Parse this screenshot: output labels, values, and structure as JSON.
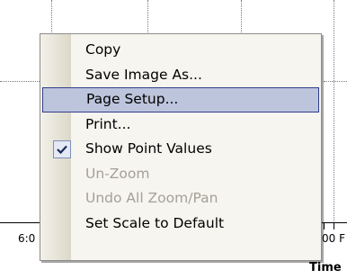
{
  "axis": {
    "tick_left": "6:0",
    "tick_right": "00 F",
    "title_fragment": "Time"
  },
  "menu": {
    "items": [
      {
        "label": "Copy",
        "state": "normal"
      },
      {
        "label": "Save Image As...",
        "state": "normal"
      },
      {
        "label": "Page Setup...",
        "state": "highlighted"
      },
      {
        "label": "Print...",
        "state": "normal"
      },
      {
        "label": "Show Point Values",
        "state": "checked"
      },
      {
        "label": "Un-Zoom",
        "state": "disabled"
      },
      {
        "label": "Undo All Zoom/Pan",
        "state": "disabled"
      },
      {
        "label": "Set Scale to Default",
        "state": "normal"
      }
    ]
  },
  "colors": {
    "highlight_fill": "#bcc5dc",
    "highlight_border": "#2f3f8a",
    "disabled_text": "#a4a097"
  }
}
